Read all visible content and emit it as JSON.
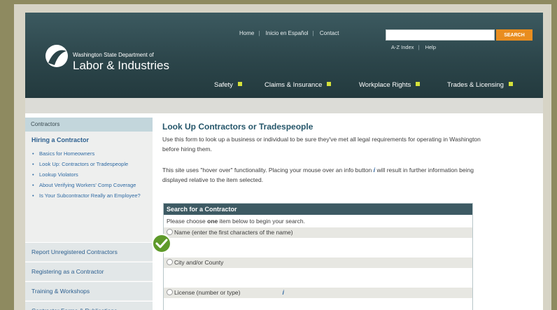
{
  "header": {
    "org_small": "Washington State Department of",
    "org_big": "Labor & Industries",
    "top_links": [
      "Home",
      "Inicio en Español",
      "Contact"
    ],
    "search_button": "SEARCH",
    "search_placeholder": "",
    "sub_links": [
      "A-Z Index",
      "Help"
    ],
    "nav": [
      "Safety",
      "Claims & Insurance",
      "Workplace Rights",
      "Trades & Licensing"
    ]
  },
  "sidebar": {
    "header": "Contractors",
    "title": "Hiring a Contractor",
    "items": [
      "Basics for Homeowners",
      "Look Up: Contractors or Tradespeople",
      "Lookup Violators",
      "About Verifying Workers' Comp Coverage",
      "Is Your Subcontractor Really an Employee?"
    ],
    "sections": [
      "Report Unregistered Contractors",
      "Registering as a Contractor",
      "Training & Workshops",
      "Contractor Forms & Publications"
    ]
  },
  "main": {
    "title": "Look Up Contractors or Tradespeople",
    "intro": "Use this form to look up a business or individual to be sure they've met all legal requirements for operating in Washington before hiring them.",
    "hover_note_a": "This site uses \"hover over\" functionality. Placing your mouse over an info button",
    "info_glyph": "i",
    "hover_note_b": "will result in further information being displayed relative to the item selected.",
    "search_box": {
      "title": "Search for a Contractor",
      "instr_pre": "Please choose ",
      "instr_bold": "one",
      "instr_post": " item below to begin your search.",
      "options": [
        "Name (enter the first characters of the name)",
        "City and/or County",
        "License (number or type)"
      ]
    }
  },
  "colors": {
    "header_bg": "#2b4449",
    "search_button": "#e98d1f",
    "nav_bullet": "#d6e23a",
    "link": "#2f6aa3",
    "check_badge": "#5e9a2a"
  }
}
